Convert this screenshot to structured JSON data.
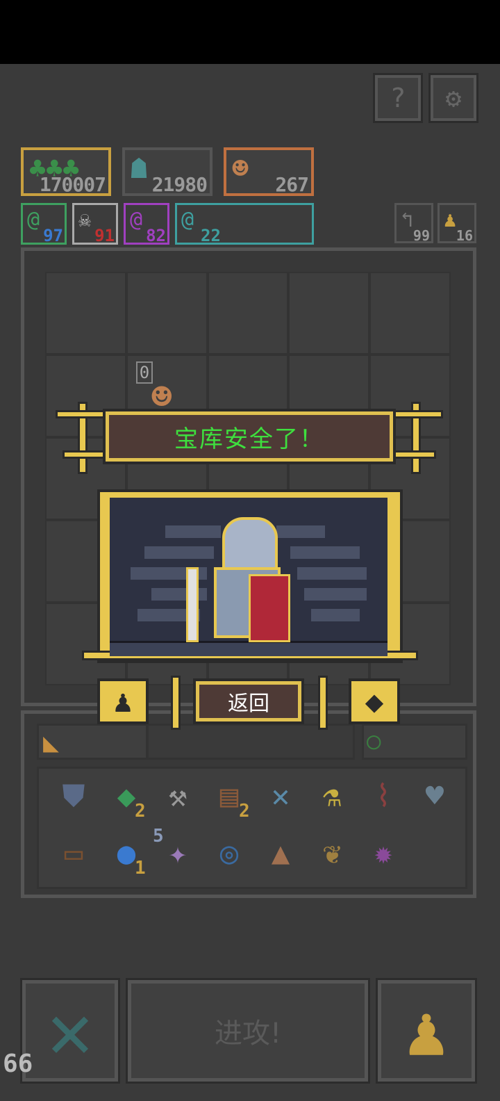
{
  "top_buttons": {
    "help_icon": "question-icon",
    "help_symbol": "?",
    "settings_icon": "gear-icon",
    "settings_symbol": "⚙"
  },
  "units": [
    {
      "name": "goblin-army",
      "count": "170007",
      "color": "#3a8f4a",
      "border": "#c8a040"
    },
    {
      "name": "orc-warrior",
      "count": "21980",
      "color": "#4a8f8f",
      "border": "#7a7a7a"
    },
    {
      "name": "dwarf-hero",
      "count": "267",
      "color": "#c08050",
      "border": "#d08040"
    }
  ],
  "resources": [
    {
      "icon": "green-swirl-icon",
      "count": "97",
      "color": "#3ea060",
      "num_color": "#3a7ad0"
    },
    {
      "icon": "skull-orb-icon",
      "count": "91",
      "color": "#bbbbbb",
      "num_color": "#c03030"
    },
    {
      "icon": "purple-swirl-icon",
      "count": "82",
      "color": "#a040c0",
      "num_color": "#a040c0"
    },
    {
      "icon": "cyan-swirl-icon",
      "count": "22",
      "color": "#3ea0a0",
      "num_color": "#3ea0a0"
    }
  ],
  "side_counters": [
    {
      "icon": "recruit-icon",
      "count": "99"
    },
    {
      "icon": "pawn-icon",
      "count": "16"
    }
  ],
  "board": {
    "hero_level": "0"
  },
  "dialog": {
    "title": "宝库安全了！",
    "back_label": "返回",
    "left_badge_icon": "pawn-icon",
    "right_badge_icon": "gem-icon"
  },
  "inventory": {
    "row1": [
      {
        "icon": "shield-icon",
        "symbol": "⛊",
        "count": ""
      },
      {
        "icon": "emerald-icon",
        "symbol": "◆",
        "count": "2"
      },
      {
        "icon": "hammer-icon",
        "symbol": "⚒",
        "count": ""
      },
      {
        "icon": "book-icon",
        "symbol": "▤",
        "count": "2"
      },
      {
        "icon": "dagger-icon",
        "symbol": "✕",
        "count": ""
      },
      {
        "icon": "potion-icon",
        "symbol": "⚗",
        "count": ""
      },
      {
        "icon": "dna-icon",
        "symbol": "⌇",
        "count": ""
      },
      {
        "icon": "heart-icon",
        "symbol": "♥",
        "count": ""
      }
    ],
    "row2": [
      {
        "icon": "chest-icon",
        "symbol": "▭",
        "count": ""
      },
      {
        "icon": "water-drop-icon",
        "symbol": "●",
        "count": "1"
      },
      {
        "icon": "star-flower-icon",
        "symbol": "✦",
        "count": "5"
      },
      {
        "icon": "coin-icon",
        "symbol": "◎",
        "count": ""
      },
      {
        "icon": "tombstone-icon",
        "symbol": "▲",
        "count": ""
      },
      {
        "icon": "leaf-icon",
        "symbol": "❦",
        "count": ""
      },
      {
        "icon": "cog-icon",
        "symbol": "✹",
        "count": ""
      }
    ]
  },
  "bottom": {
    "cancel_icon": "cross-icon",
    "cancel_symbol": "✕",
    "attack_label": "进攻!",
    "pawn_icon": "pawn-icon",
    "pawn_symbol": "♟",
    "fps": "66"
  },
  "colors": {
    "gold": "#e8c850",
    "title_green": "#3ee03e",
    "dialog_bg": "#4e3a36"
  }
}
